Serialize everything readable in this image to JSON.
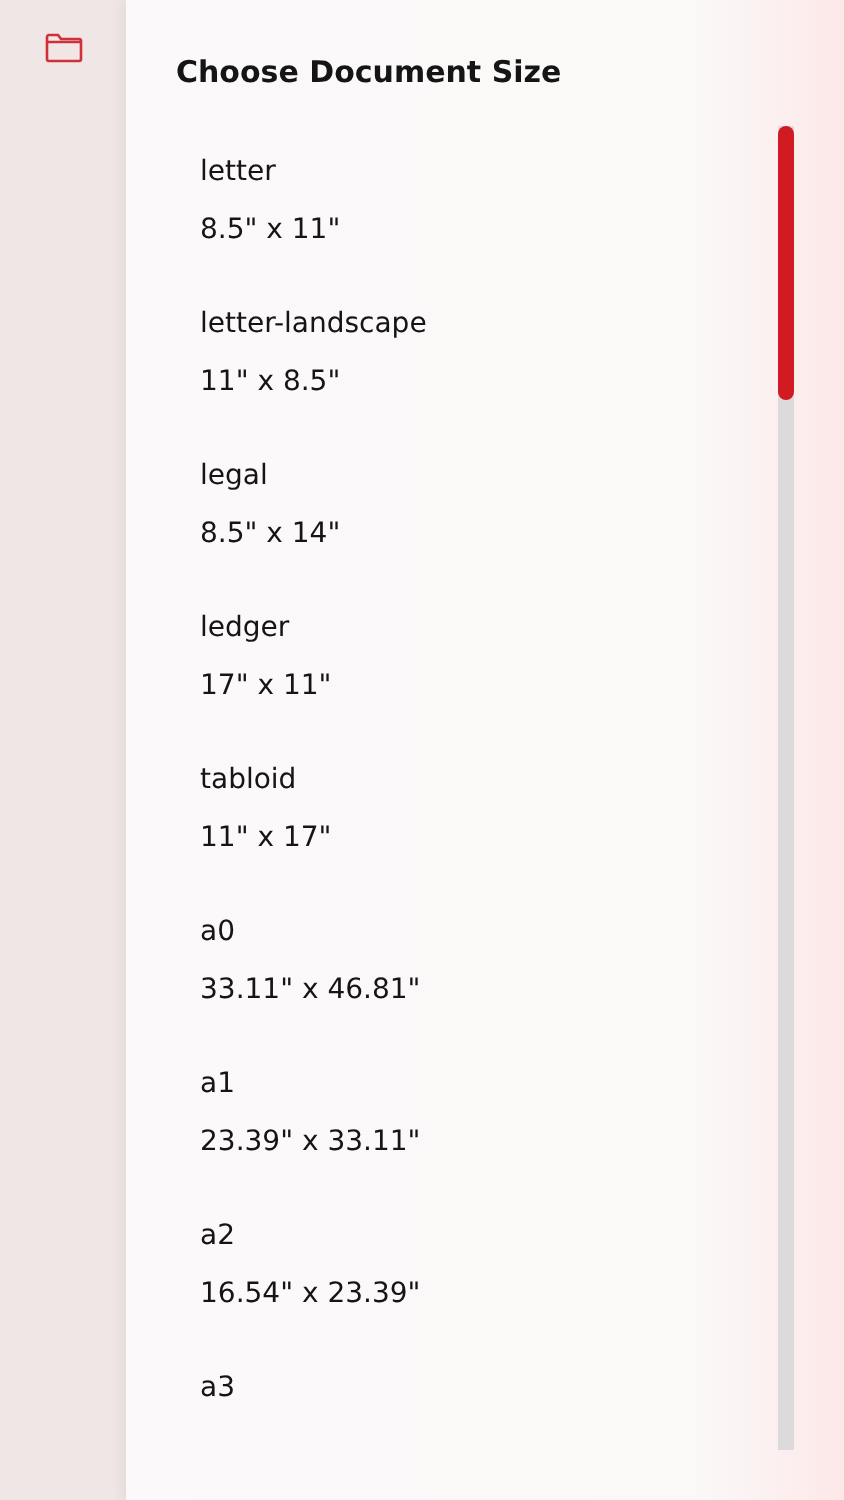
{
  "dialog": {
    "title": "Choose Document Size"
  },
  "sizes": [
    {
      "name": "letter",
      "dimensions": "8.5\" x 11\""
    },
    {
      "name": "letter-landscape",
      "dimensions": "11\" x 8.5\""
    },
    {
      "name": "legal",
      "dimensions": "8.5\" x 14\""
    },
    {
      "name": "ledger",
      "dimensions": "17\" x 11\""
    },
    {
      "name": "tabloid",
      "dimensions": "11\" x 17\""
    },
    {
      "name": "a0",
      "dimensions": "33.11\" x 46.81\""
    },
    {
      "name": "a1",
      "dimensions": "23.39\" x 33.11\""
    },
    {
      "name": "a2",
      "dimensions": "16.54\" x 23.39\""
    },
    {
      "name": "a3"
    }
  ]
}
